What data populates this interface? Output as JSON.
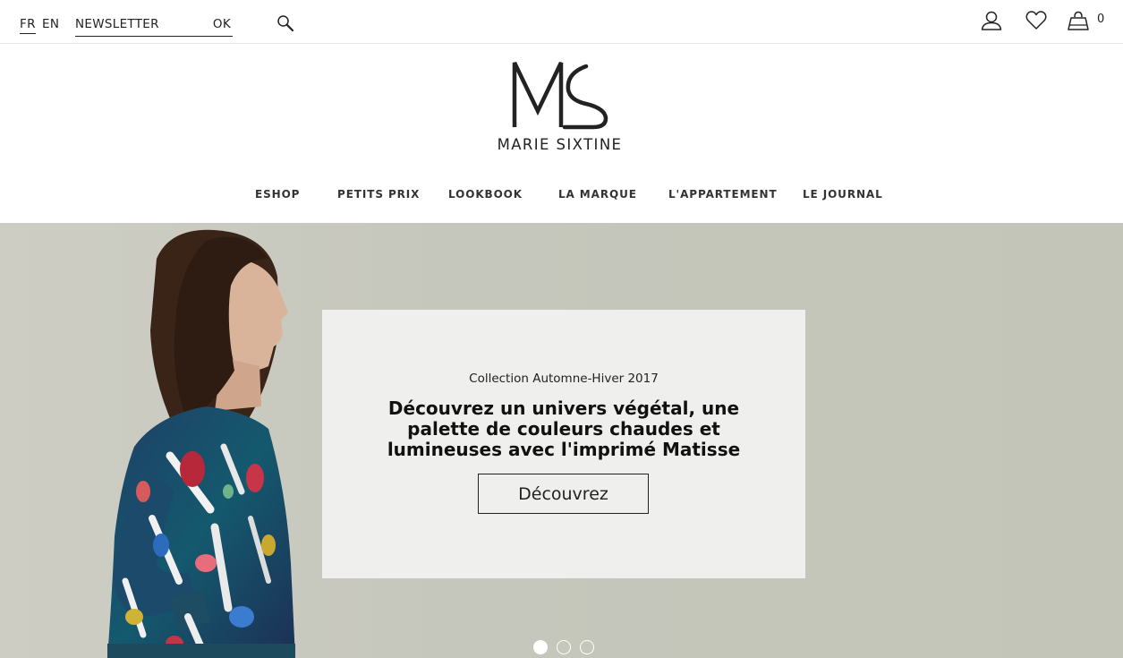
{
  "topbar": {
    "lang_fr": "FR",
    "lang_en": "EN",
    "newsletter_placeholder": "NEWSLETTER",
    "newsletter_submit": "OK",
    "cart_count": "0"
  },
  "logo": {
    "brand": "MARIE SIXTINE"
  },
  "nav": {
    "items": [
      "ESHOP",
      "PETITS PRIX",
      "LOOKBOOK",
      "LA MARQUE",
      "L'APPARTEMENT",
      "LE JOURNAL"
    ]
  },
  "hero": {
    "kicker": "Collection Automne-Hiver 2017",
    "headline": "Découvrez un univers végétal, une palette de couleurs chaudes et lumineuses avec l'imprimé Matisse",
    "cta": "Découvrez",
    "slides_total": 3,
    "active_slide": 1
  },
  "icons": [
    "search-icon",
    "user-icon",
    "heart-icon",
    "cart-icon"
  ],
  "colors": {
    "text": "#1a1a1a",
    "hero_bg": "#c6c7bc",
    "panel_bg": "#efefed"
  }
}
